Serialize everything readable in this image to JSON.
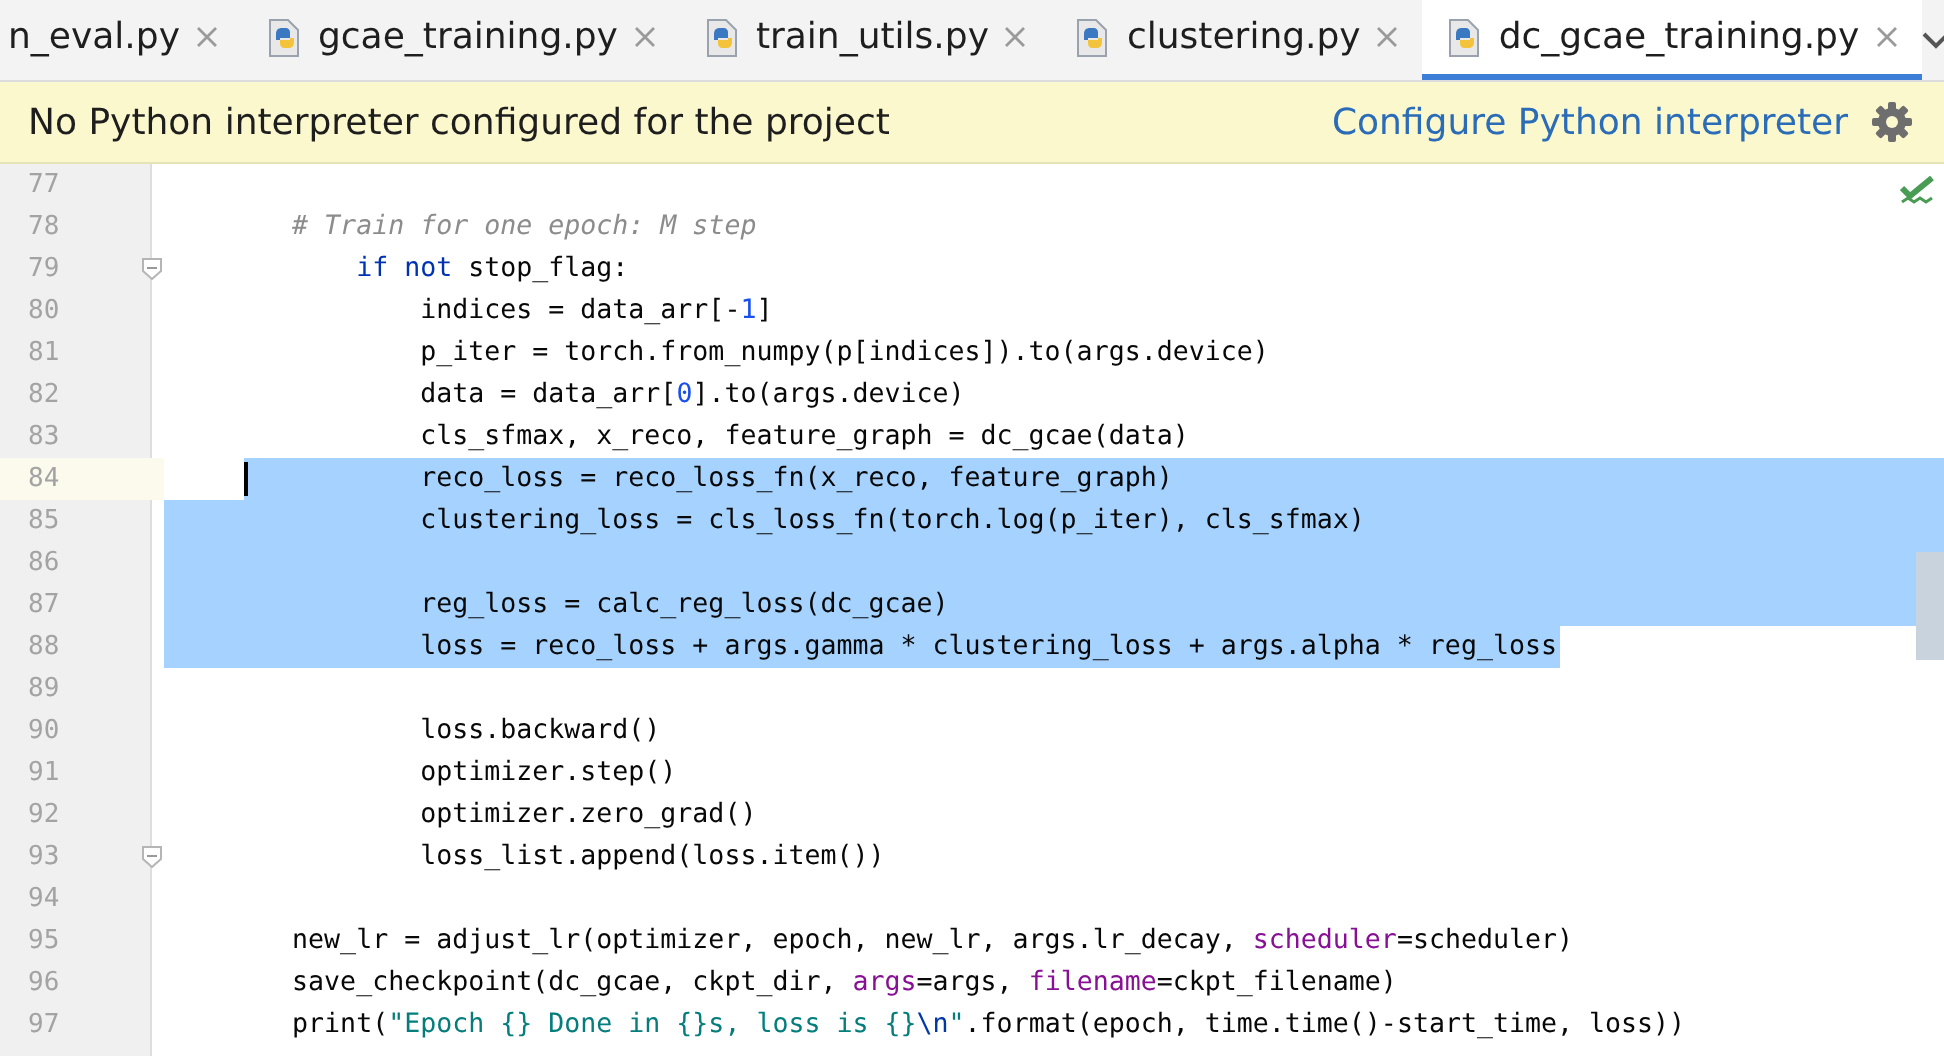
{
  "tabs": [
    {
      "label": "n_eval.py",
      "selected": false
    },
    {
      "label": "gcae_training.py",
      "selected": false
    },
    {
      "label": "train_utils.py",
      "selected": false
    },
    {
      "label": "clustering.py",
      "selected": false
    },
    {
      "label": "dc_gcae_training.py",
      "selected": true
    }
  ],
  "banner": {
    "message": "No Python interpreter configured for the project",
    "link": "Configure Python interpreter"
  },
  "editor": {
    "lines": [
      {
        "number": "77",
        "selected": false,
        "current": false,
        "caret": false,
        "fold": false
      },
      {
        "number": "78",
        "selected": false,
        "current": false,
        "caret": false,
        "fold": false,
        "tokens": [
          {
            "kind": "comment",
            "text": "        # Train for one epoch: M step"
          }
        ]
      },
      {
        "number": "79",
        "selected": false,
        "current": false,
        "caret": false,
        "fold": true,
        "tokens": [
          {
            "kind": "keyword",
            "text": "            if not"
          },
          {
            "kind": "plain",
            "text": " stop_flag:"
          }
        ]
      },
      {
        "number": "80",
        "selected": false,
        "current": false,
        "caret": false,
        "fold": false,
        "tokens": [
          {
            "kind": "plain",
            "text": "                indices = data_arr[-"
          },
          {
            "kind": "number",
            "text": "1"
          },
          {
            "kind": "plain",
            "text": "]"
          }
        ]
      },
      {
        "number": "81",
        "selected": false,
        "current": false,
        "caret": false,
        "fold": false,
        "tokens": [
          {
            "kind": "plain",
            "text": "                p_iter = torch.from_numpy(p[indices]).to(args.device)"
          }
        ]
      },
      {
        "number": "82",
        "selected": false,
        "current": false,
        "caret": false,
        "fold": false,
        "tokens": [
          {
            "kind": "plain",
            "text": "                data = data_arr["
          },
          {
            "kind": "number",
            "text": "0"
          },
          {
            "kind": "plain",
            "text": "].to(args.device)"
          }
        ]
      },
      {
        "number": "83",
        "selected": false,
        "current": false,
        "caret": false,
        "fold": false,
        "tokens": [
          {
            "kind": "plain",
            "text": "                cls_sfmax, x_reco, feature_graph = dc_gcae(data)"
          }
        ]
      },
      {
        "number": "84",
        "selected": true,
        "current": true,
        "caret": true,
        "fold": false,
        "tokens": [
          {
            "kind": "plain",
            "text": "                reco_loss = reco_loss_fn(x_reco, feature_graph)"
          }
        ]
      },
      {
        "number": "85",
        "selected": true,
        "current": false,
        "caret": false,
        "fold": false,
        "tokens": [
          {
            "kind": "plain",
            "text": "                clustering_loss = cls_loss_fn(torch.log(p_iter), cls_sfmax)"
          }
        ]
      },
      {
        "number": "86",
        "selected": true,
        "current": false,
        "caret": false,
        "fold": false
      },
      {
        "number": "87",
        "selected": true,
        "current": false,
        "caret": false,
        "fold": false,
        "tokens": [
          {
            "kind": "plain",
            "text": "                reg_loss = calc_reg_loss(dc_gcae)"
          }
        ]
      },
      {
        "number": "88",
        "selected": true,
        "current": false,
        "caret": false,
        "fold": false,
        "tokens": [
          {
            "kind": "plain",
            "text": "                loss = reco_loss + args.gamma * clustering_loss + args.alpha * reg_loss"
          }
        ]
      },
      {
        "number": "89",
        "selected": false,
        "current": false,
        "caret": false,
        "fold": false
      },
      {
        "number": "90",
        "selected": false,
        "current": false,
        "caret": false,
        "fold": false,
        "tokens": [
          {
            "kind": "plain",
            "text": "                loss.backward()"
          }
        ]
      },
      {
        "number": "91",
        "selected": false,
        "current": false,
        "caret": false,
        "fold": false,
        "tokens": [
          {
            "kind": "plain",
            "text": "                optimizer.step()"
          }
        ]
      },
      {
        "number": "92",
        "selected": false,
        "current": false,
        "caret": false,
        "fold": false,
        "tokens": [
          {
            "kind": "plain",
            "text": "                optimizer.zero_grad()"
          }
        ]
      },
      {
        "number": "93",
        "selected": false,
        "current": false,
        "caret": false,
        "fold": true,
        "tokens": [
          {
            "kind": "plain",
            "text": "                loss_list.append(loss.item())"
          }
        ]
      },
      {
        "number": "94",
        "selected": false,
        "current": false,
        "caret": false,
        "fold": false
      },
      {
        "number": "95",
        "selected": false,
        "current": false,
        "caret": false,
        "fold": false,
        "tokens": [
          {
            "kind": "plain",
            "text": "        new_lr = adjust_lr(optimizer, epoch, new_lr, args.lr_decay, "
          },
          {
            "kind": "param",
            "text": "scheduler"
          },
          {
            "kind": "plain",
            "text": "=scheduler)"
          }
        ]
      },
      {
        "number": "96",
        "selected": false,
        "current": false,
        "caret": false,
        "fold": false,
        "tokens": [
          {
            "kind": "plain",
            "text": "        save_checkpoint(dc_gcae, ckpt_dir, "
          },
          {
            "kind": "param",
            "text": "args"
          },
          {
            "kind": "plain",
            "text": "=args, "
          },
          {
            "kind": "param",
            "text": "filename"
          },
          {
            "kind": "plain",
            "text": "=ckpt_filename)"
          }
        ]
      },
      {
        "number": "97",
        "selected": false,
        "current": false,
        "caret": false,
        "fold": false,
        "tokens": [
          {
            "kind": "plain",
            "text": "        print("
          },
          {
            "kind": "string",
            "text": "\"Epoch {} Done in {}s, loss is {}"
          },
          {
            "kind": "escape",
            "text": "\\n"
          },
          {
            "kind": "string",
            "text": "\""
          },
          {
            "kind": "plain",
            "text": ".format(epoch, time.time()-start_time, loss))"
          }
        ]
      }
    ]
  }
}
